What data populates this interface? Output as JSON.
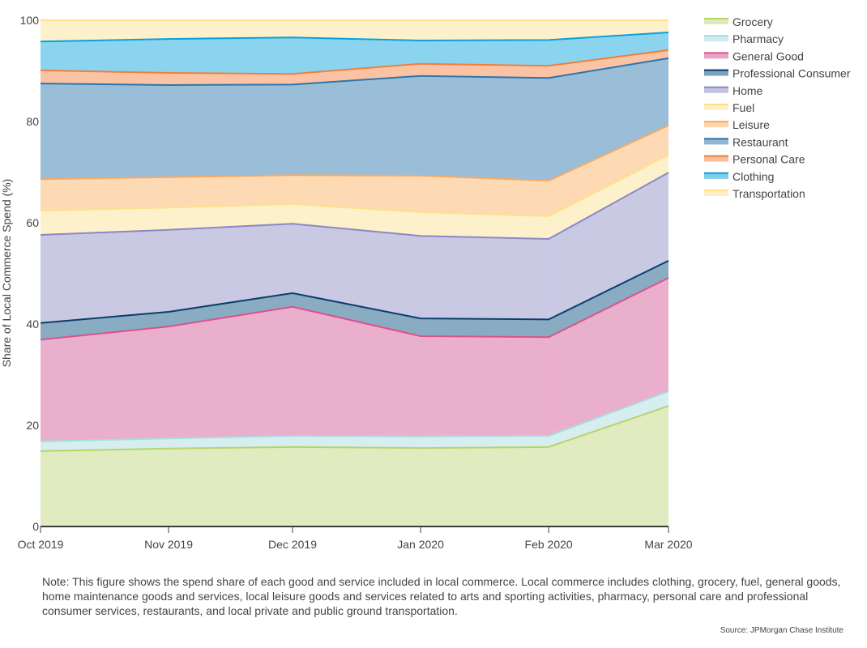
{
  "chart_data": {
    "type": "area",
    "stacked": true,
    "title": "",
    "xlabel": "",
    "ylabel": "Share of Local Commerce Spend (%)",
    "x": [
      "Oct 2019",
      "Nov 2019",
      "Dec 2019",
      "Jan 2020",
      "Feb 2020",
      "Mar 2020"
    ],
    "x_day_offsets": [
      0,
      31,
      61,
      92,
      123,
      152
    ],
    "ylim": [
      0,
      100
    ],
    "yticks": [
      0,
      20,
      40,
      60,
      80,
      100
    ],
    "grid": true,
    "legend_position": "right",
    "series": [
      {
        "name": "Grocery",
        "line": "#b5d56a",
        "fill": "#dde9b8",
        "values": [
          14.9,
          15.4,
          15.7,
          15.5,
          15.7,
          23.8
        ]
      },
      {
        "name": "Pharmacy",
        "line": "#a6dde0",
        "fill": "#d1ecee",
        "values": [
          1.9,
          2.0,
          2.2,
          2.3,
          2.2,
          2.9
        ]
      },
      {
        "name": "General Good",
        "line": "#d9538e",
        "fill": "#e8a6c6",
        "values": [
          20.1,
          22.1,
          25.5,
          19.8,
          19.5,
          22.4
        ]
      },
      {
        "name": "Professional Consumer",
        "line": "#0b3e6b",
        "fill": "#7ca3bb",
        "values": [
          3.3,
          2.9,
          2.7,
          3.5,
          3.5,
          3.4
        ]
      },
      {
        "name": "Home",
        "line": "#8d87c3",
        "fill": "#c4c3e1",
        "values": [
          17.4,
          16.2,
          13.7,
          16.3,
          15.9,
          17.4
        ]
      },
      {
        "name": "Fuel",
        "line": "#fde08b",
        "fill": "#fdefc6",
        "values": [
          4.8,
          4.4,
          3.9,
          4.7,
          4.5,
          3.5
        ]
      },
      {
        "name": "Leisure",
        "line": "#f8aa64",
        "fill": "#fdd6ac",
        "values": [
          6.2,
          6.0,
          5.7,
          7.2,
          7.0,
          5.8
        ]
      },
      {
        "name": "Restaurant",
        "line": "#2e75ae",
        "fill": "#8fb6d4",
        "values": [
          18.9,
          18.2,
          17.9,
          19.7,
          20.3,
          13.3
        ]
      },
      {
        "name": "Personal Care",
        "line": "#f07f3c",
        "fill": "#f9be9a",
        "values": [
          2.6,
          2.4,
          2.1,
          2.4,
          2.4,
          1.6
        ]
      },
      {
        "name": "Clothing",
        "line": "#0e9fd8",
        "fill": "#7dcfee",
        "values": [
          5.7,
          6.7,
          7.2,
          4.6,
          5.1,
          3.5
        ]
      },
      {
        "name": "Transportation",
        "line": "#fde08b",
        "fill": "#fdefc6",
        "values": [
          4.2,
          3.7,
          3.4,
          4.0,
          3.9,
          2.4
        ]
      }
    ]
  },
  "note": "Note: This figure shows the spend share of each good and service included in local commerce. Local commerce includes clothing, grocery, fuel, general goods, home maintenance goods and services, local leisure goods and services related to arts and sporting activities, pharmacy, personal care and professional consumer services, restaurants, and local private and public ground transportation.",
  "source": "Source: JPMorgan Chase Institute"
}
